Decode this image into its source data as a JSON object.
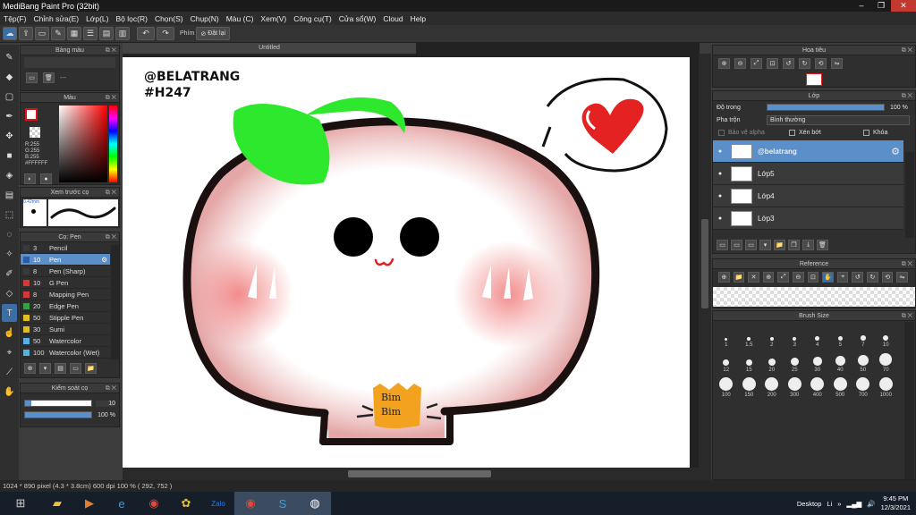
{
  "app": {
    "title": "MediBang Paint Pro (32bit)"
  },
  "menu": [
    "Tệp(F)",
    "Chỉnh sửa(E)",
    "Lớp(L)",
    "Bộ lọc(R)",
    "Chọn(S)",
    "Chụp(N)",
    "Màu (C)",
    "Xem(V)",
    "Công cụ(T)",
    "Cửa sổ(W)",
    "Cloud",
    "Help"
  ],
  "toolbar": {
    "snap_label": "Phím",
    "reset_label": "Đặt lại"
  },
  "document": {
    "tab": "Untitled"
  },
  "palette": {
    "title": "Bảng màu",
    "placeholder": "---"
  },
  "color": {
    "title": "Màu",
    "r": "R:255",
    "g": "G:255",
    "b": "B:255",
    "hex": "#FFFFFF"
  },
  "preview": {
    "title": "Xem trước cọ",
    "size": "0.42mm"
  },
  "brush": {
    "title": "Cọ: Pen",
    "items": [
      {
        "size": "3",
        "name": "Pencil",
        "color": "#3a3a3a"
      },
      {
        "size": "10",
        "name": "Pen",
        "color": "#2a5ca8",
        "selected": true
      },
      {
        "size": "8",
        "name": "Pen (Sharp)",
        "color": "#3a3a3a"
      },
      {
        "size": "10",
        "name": "G Pen",
        "color": "#d23a3a"
      },
      {
        "size": "8",
        "name": "Mapping Pen",
        "color": "#d23a3a"
      },
      {
        "size": "20",
        "name": "Edge Pen",
        "color": "#2aa83a"
      },
      {
        "size": "50",
        "name": "Stipple Pen",
        "color": "#e0c020"
      },
      {
        "size": "30",
        "name": "Sumi",
        "color": "#e0c020"
      },
      {
        "size": "50",
        "name": "Watercolor",
        "color": "#5ab0e0"
      },
      {
        "size": "100",
        "name": "Watercolor (Wet)",
        "color": "#5ab0e0"
      }
    ]
  },
  "brush_control": {
    "title": "Kiểm soát cọ",
    "size_value": "10",
    "opacity_value": "100 %",
    "size_fraction": 0.1,
    "opacity_fraction": 1.0
  },
  "navigator": {
    "title": "Hoa tiêu"
  },
  "layers": {
    "title": "Lớp",
    "opacity_label": "Độ trong",
    "opacity_value": "100 %",
    "blend_label": "Pha trộn",
    "blend_value": "Bình thường",
    "protect_alpha": "Bảo vệ alpha",
    "clipping": "Xén bớt",
    "lock": "Khóa",
    "items": [
      {
        "name": "@belatrang",
        "selected": true
      },
      {
        "name": "Lớp5"
      },
      {
        "name": "Lớp4"
      },
      {
        "name": "Lớp3"
      }
    ]
  },
  "reference": {
    "title": "Reference"
  },
  "brush_size": {
    "title": "Brush Size",
    "sizes": [
      "1",
      "1.5",
      "2",
      "3",
      "4",
      "5",
      "7",
      "10",
      "12",
      "15",
      "20",
      "25",
      "30",
      "40",
      "50",
      "70",
      "100",
      "150",
      "200",
      "300",
      "400",
      "500",
      "700",
      "1000"
    ]
  },
  "artwork": {
    "watermark_1": "@BELATRANG",
    "watermark_2": "#H247",
    "label_1": "Bim",
    "label_2": "Bim"
  },
  "status": {
    "text": "1024 * 890 pixel  (4.3 * 3.8cm)  600 dpi  100 %  ( 292, 752 )"
  },
  "taskbar": {
    "desktop": "Desktop",
    "lang": "Li",
    "time": "9:45 PM",
    "date": "12/3/2021"
  },
  "colors": {
    "accent": "#5b8fc9",
    "panel": "#2f2f2f",
    "green": "#2ee82e",
    "heart": "#e52222",
    "bag": "#f2a21f"
  }
}
